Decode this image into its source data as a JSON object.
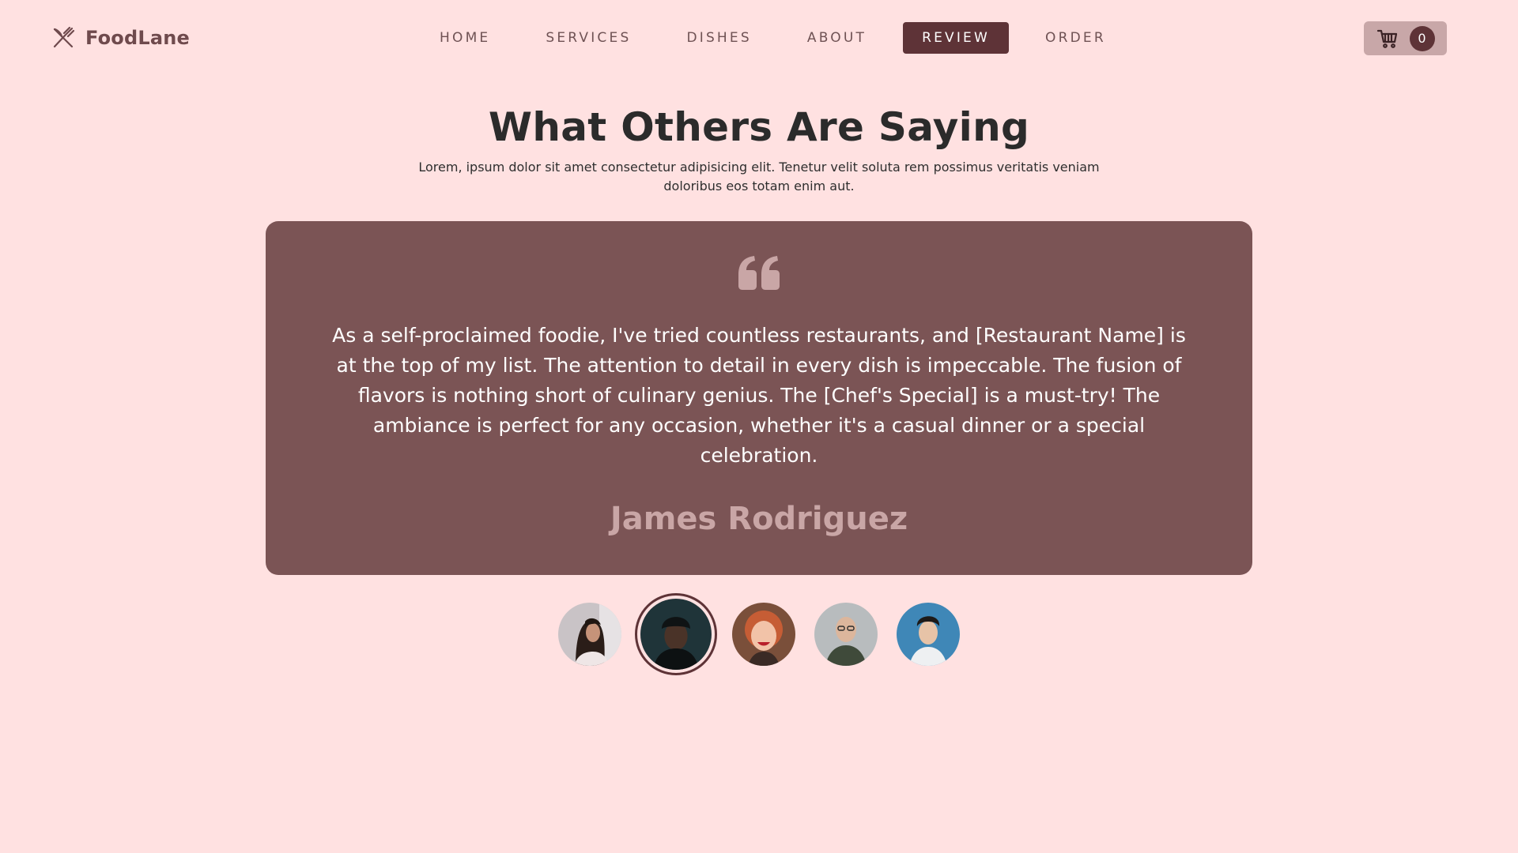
{
  "brand": {
    "name": "FoodLane"
  },
  "nav": {
    "items": [
      {
        "label": "HOME",
        "active": false
      },
      {
        "label": "SERVICES",
        "active": false
      },
      {
        "label": "DISHES",
        "active": false
      },
      {
        "label": "ABOUT",
        "active": false
      },
      {
        "label": "REVIEW",
        "active": true
      },
      {
        "label": "ORDER",
        "active": false
      }
    ]
  },
  "cart": {
    "count": "0",
    "icon": "shopping-cart-icon"
  },
  "section": {
    "title": "What Others Are Saying",
    "subtitle": "Lorem, ipsum dolor sit amet consectetur adipisicing elit. Tenetur velit soluta rem possimus veritatis veniam doloribus eos totam enim aut."
  },
  "review": {
    "text": "As a self-proclaimed foodie, I've tried countless restaurants, and [Restaurant Name] is at the top of my list. The attention to detail in every dish is impeccable. The fusion of flavors is nothing short of culinary genius. The [Chef's Special] is a must-try! The ambiance is perfect for any occasion, whether it's a casual dinner or a special celebration.",
    "author": "James Rodriguez"
  },
  "avatars": {
    "selected_index": 1,
    "count": 5
  },
  "colors": {
    "background": "#ffe1e1",
    "accent": "#5e3337",
    "card": "#7b5455",
    "author": "#c9a6a6",
    "cart_bg": "#c8a7a8"
  }
}
